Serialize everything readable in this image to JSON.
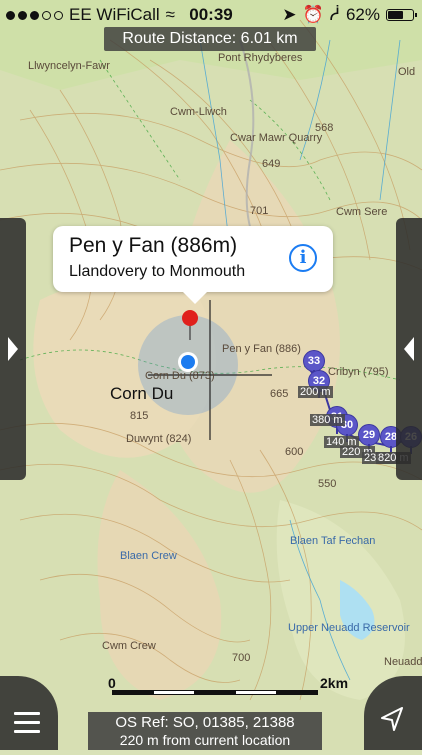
{
  "status": {
    "carrier": "EE WiFiCall",
    "time": "00:39",
    "battery": "62%",
    "battery_level": 0.62,
    "signal_bars_filled": 3,
    "signal_bars_total": 5
  },
  "route_banner": "Route Distance: 6.01 km",
  "callout": {
    "title": "Pen y Fan (886m)",
    "subtitle": "Llandovery to Monmouth"
  },
  "map_labels": {
    "llwyncelyn": "Llwyncelyn-Fawr",
    "cwm_llwch": "Cwm-Llwch",
    "cwar_mawr": "Cwar Mawr Quarry",
    "h568": "568",
    "h649": "649",
    "h701": "701",
    "cwm_sere": "Cwm Sere",
    "pen_y_fan": "Pen y Fan (886)",
    "corn_du_small": "Corn Du (873)",
    "corn_du": "Corn Du",
    "h815": "815",
    "duwynt": "Duwynt (824)",
    "h665": "665",
    "cribyn": "Cribyn (795)",
    "h600": "600",
    "h550": "550",
    "blaen_taf": "Blaen Taf Fechan",
    "blaen_crew": "Blaen Crew",
    "upper_neuadd": "Upper Neuadd Reservoir",
    "cwm_crew": "Cwm Crew",
    "h700": "700",
    "neuadd": "Neuadd",
    "pont": "Pont Rhydyberes",
    "old": "Old"
  },
  "waypoints": [
    "33",
    "32",
    "31",
    "30",
    "29",
    "28",
    "26"
  ],
  "distance_tags": [
    "200 m",
    "380 m",
    "140 m",
    "220 m",
    "230 m",
    "820 m"
  ],
  "scale": {
    "start": "0",
    "end": "2km"
  },
  "bottom": {
    "os_ref": "OS Ref: SO, 01385, 21388",
    "distance": "220 m from current location"
  }
}
